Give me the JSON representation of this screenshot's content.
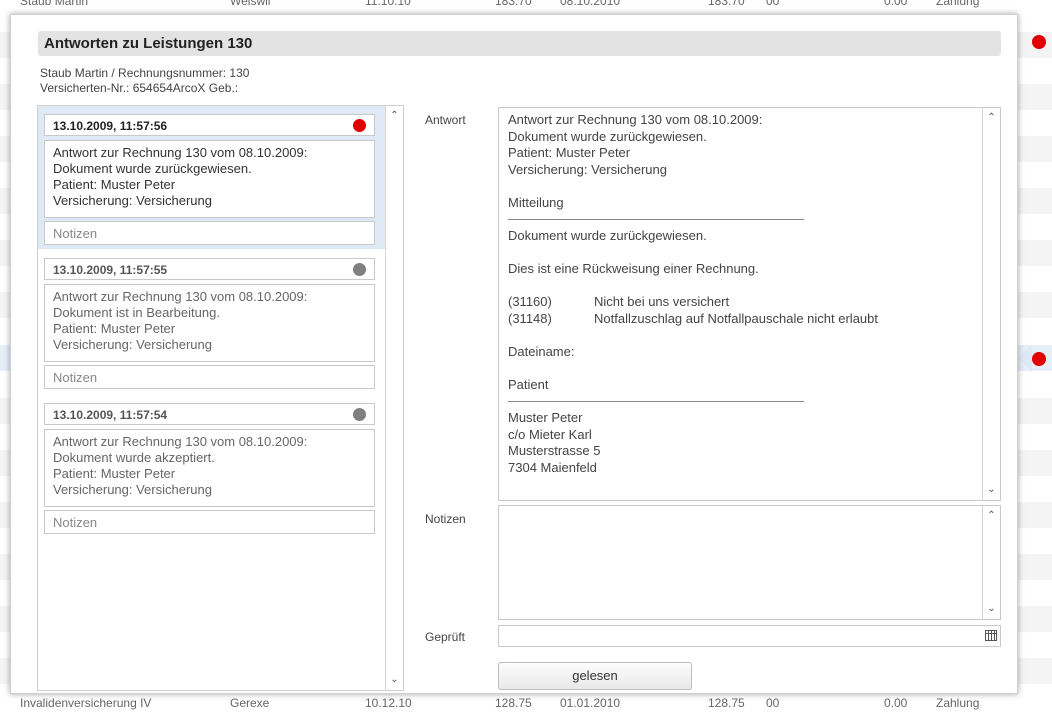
{
  "background": {
    "top_row": [
      "Staub Martin",
      "Weiswil",
      "11.10.10",
      "183.70",
      "08.10.2010",
      "183.70",
      "00",
      "0.00",
      "Zahlung"
    ],
    "bottom_row": [
      "Invalidenversicherung IV",
      "Gerexe",
      "10.12.10",
      "128.75",
      "01.01.2010",
      "128.75",
      "00",
      "0.00",
      "Zahlung"
    ],
    "status_color": "#e00000"
  },
  "dialog": {
    "title": "Antworten zu Leistungen 130",
    "patient_line": "Staub Martin / Rechnungsnummer: 130",
    "insurance_line": "Versicherten-Nr.: 654654ArcoX  Geb.:"
  },
  "entries": [
    {
      "timestamp": "13.10.2009, 11:57:56",
      "status_color": "#e00000",
      "lines": [
        "Antwort zur Rechnung 130 vom 08.10.2009:",
        "Dokument wurde zurückgewiesen.",
        "Patient: Muster Peter",
        "Versicherung: Versicherung"
      ],
      "notes_placeholder": "Notizen"
    },
    {
      "timestamp": "13.10.2009, 11:57:55",
      "status_color": "#808080",
      "lines": [
        "Antwort zur Rechnung 130 vom 08.10.2009:",
        "Dokument ist in Bearbeitung.",
        "Patient: Muster Peter",
        "Versicherung: Versicherung"
      ],
      "notes_placeholder": "Notizen"
    },
    {
      "timestamp": "13.10.2009, 11:57:54",
      "status_color": "#808080",
      "lines": [
        "Antwort zur Rechnung 130 vom 08.10.2009:",
        "Dokument wurde akzeptiert.",
        "Patient: Muster Peter",
        "Versicherung: Versicherung"
      ],
      "notes_placeholder": "Notizen"
    }
  ],
  "detail": {
    "answer_label": "Antwort",
    "answer": {
      "header": [
        "Antwort zur Rechnung 130 vom 08.10.2009:",
        "Dokument wurde zurückgewiesen.",
        "Patient: Muster Peter",
        "Versicherung: Versicherung"
      ],
      "mitteilung_title": "Mitteilung",
      "mitteilung_text": "Dokument wurde zurückgewiesen.",
      "rejection_text": "Dies ist eine Rückweisung einer Rechnung.",
      "codes": [
        {
          "code": "(31160)",
          "text": "Nicht bei uns versichert"
        },
        {
          "code": "(31148)",
          "text": "Notfallzuschlag auf Notfallpauschale nicht erlaubt"
        }
      ],
      "filename_label": "Dateiname:",
      "patient_title": "Patient",
      "address": [
        "Muster Peter",
        "c/o Mieter Karl",
        "Musterstrasse 5",
        "7304 Maienfeld"
      ]
    },
    "notes_label": "Notizen",
    "notes_value": "",
    "checked_label": "Geprüft",
    "checked_value": "",
    "read_button": "gelesen"
  },
  "icons": {
    "scroll_up": "chevron-up-icon",
    "scroll_down": "chevron-down-icon",
    "calendar": "calendar-icon"
  }
}
